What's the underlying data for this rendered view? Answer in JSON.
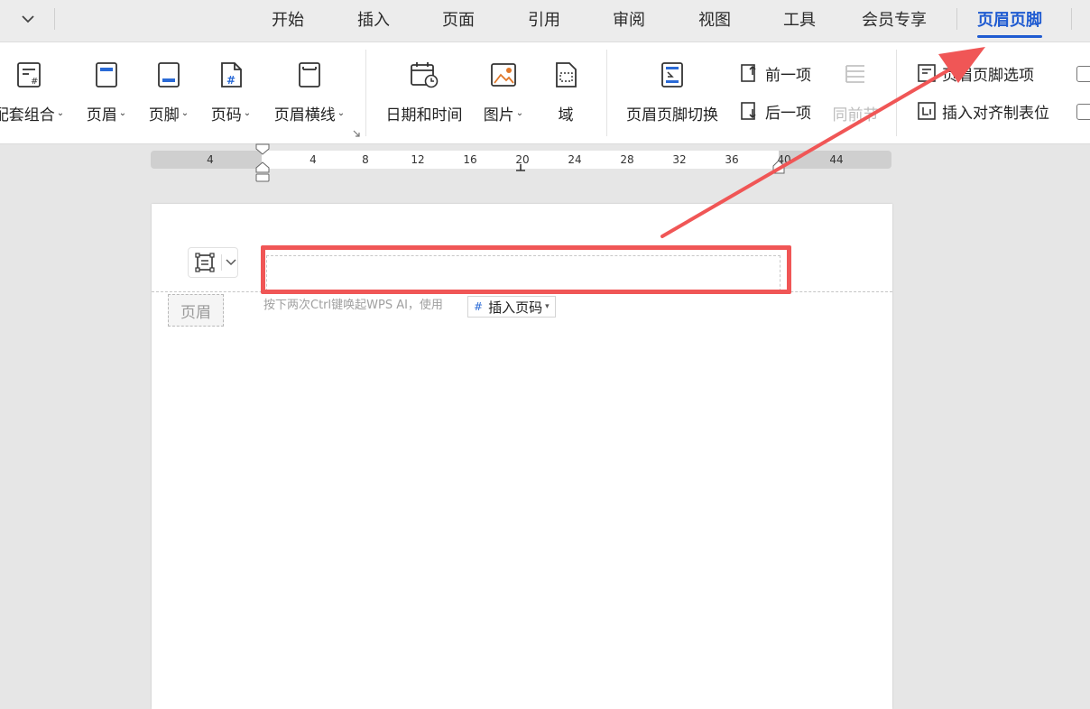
{
  "tabs": [
    {
      "label": "开始"
    },
    {
      "label": "插入"
    },
    {
      "label": "页面"
    },
    {
      "label": "引用"
    },
    {
      "label": "审阅"
    },
    {
      "label": "视图"
    },
    {
      "label": "工具"
    },
    {
      "label": "会员专享"
    },
    {
      "label": "页眉页脚",
      "active": true
    }
  ],
  "ribbon": {
    "set_combo": "配套组合",
    "header": "页眉",
    "footer": "页脚",
    "page_number": "页码",
    "header_line": "页眉横线",
    "date_time": "日期和时间",
    "picture": "图片",
    "field": "域",
    "switch": "页眉页脚切换",
    "previous": "前一项",
    "next": "后一项",
    "same_as_previous": "同前节",
    "options": "页眉页脚选项",
    "insert_align_tab": "插入对齐制表位"
  },
  "ruler": {
    "ticks": [
      "4",
      "4",
      "8",
      "12",
      "16",
      "20",
      "24",
      "28",
      "32",
      "36",
      "40",
      "44"
    ]
  },
  "document": {
    "header_tag": "页眉",
    "ai_hint": "按下两次Ctrl键唤起WPS AI，使用",
    "insert_page_number": "插入页码"
  },
  "colors": {
    "accent": "#1f5bd1",
    "annotation": "#f05656"
  }
}
